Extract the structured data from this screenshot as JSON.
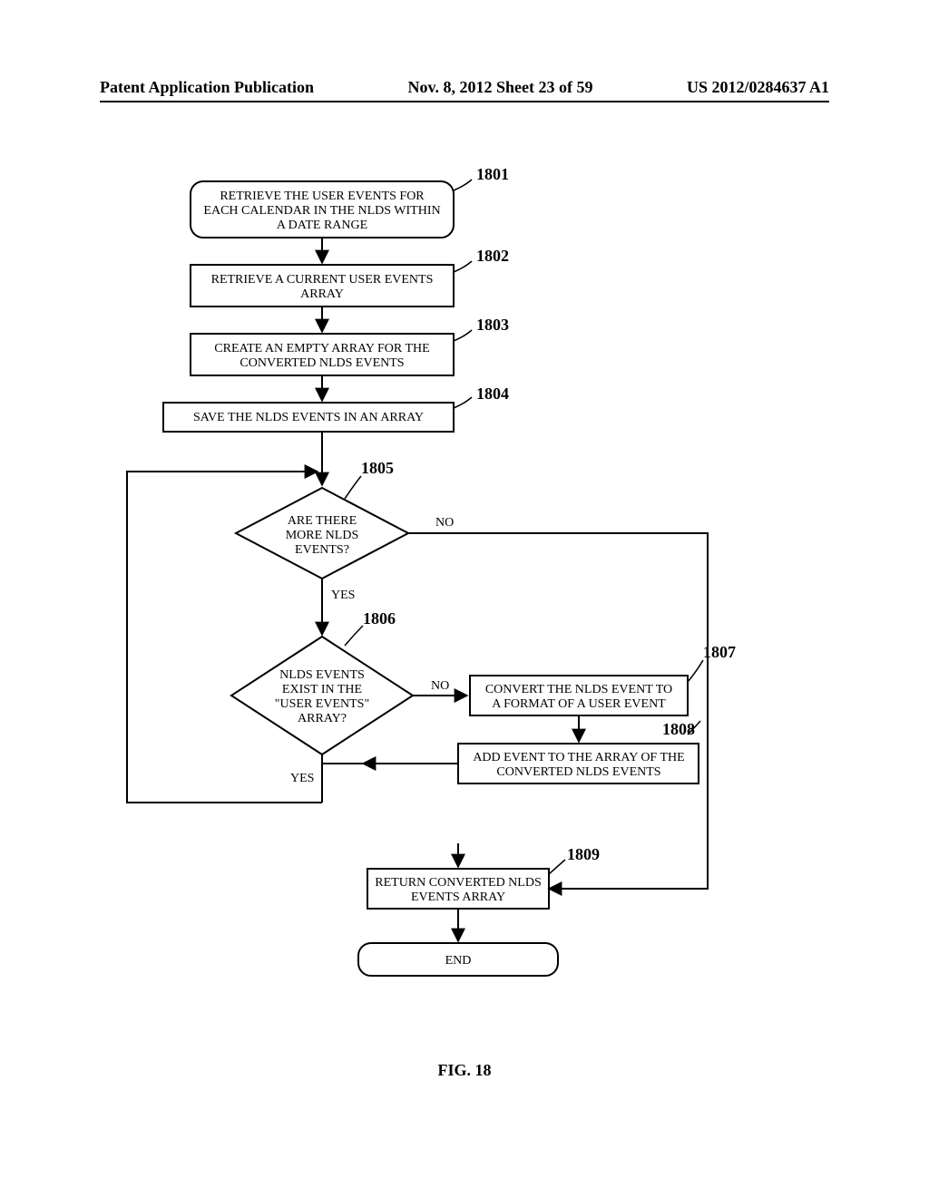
{
  "header": {
    "left": "Patent Application Publication",
    "center": "Nov. 8, 2012  Sheet 23 of 59",
    "right": "US 2012/0284637 A1"
  },
  "figure_caption": "FIG. 18",
  "chart_data": {
    "type": "flowchart",
    "nodes": [
      {
        "id": "1801",
        "shape": "rounded",
        "text": "RETRIEVE THE USER EVENTS FOR EACH CALENDAR IN THE NLDS WITHIN A DATE RANGE"
      },
      {
        "id": "1802",
        "shape": "rect",
        "text": "RETRIEVE A CURRENT USER EVENTS ARRAY"
      },
      {
        "id": "1803",
        "shape": "rect",
        "text": "CREATE AN EMPTY ARRAY FOR THE CONVERTED NLDS EVENTS"
      },
      {
        "id": "1804",
        "shape": "rect",
        "text": "SAVE THE NLDS EVENTS IN AN ARRAY"
      },
      {
        "id": "1805",
        "shape": "diamond",
        "text": "ARE THERE MORE NLDS EVENTS?"
      },
      {
        "id": "1806",
        "shape": "diamond",
        "text": "NLDS EVENTS EXIST IN THE \"USER EVENTS\" ARRAY?"
      },
      {
        "id": "1807",
        "shape": "rect",
        "text": "CONVERT THE NLDS EVENT TO A FORMAT OF A USER EVENT"
      },
      {
        "id": "1808",
        "shape": "rect",
        "text": "ADD EVENT TO THE ARRAY OF THE CONVERTED NLDS EVENTS"
      },
      {
        "id": "1809",
        "shape": "rect",
        "text": "RETURN CONVERTED NLDS EVENTS ARRAY"
      },
      {
        "id": "end",
        "shape": "rounded",
        "text": "END"
      }
    ],
    "edges": [
      {
        "from": "1801",
        "to": "1802"
      },
      {
        "from": "1802",
        "to": "1803"
      },
      {
        "from": "1803",
        "to": "1804"
      },
      {
        "from": "1804",
        "to": "1805"
      },
      {
        "from": "1805",
        "to": "1806",
        "label": "YES"
      },
      {
        "from": "1805",
        "to": "1809",
        "label": "NO"
      },
      {
        "from": "1806",
        "to": "1807",
        "label": "NO"
      },
      {
        "from": "1806",
        "to": "1805",
        "label": "YES",
        "note": "loop back"
      },
      {
        "from": "1807",
        "to": "1808"
      },
      {
        "from": "1808",
        "to": "1805",
        "note": "loop back"
      },
      {
        "from": "1809",
        "to": "end"
      }
    ]
  },
  "labels": {
    "n1801": "1801",
    "n1802": "1802",
    "n1803": "1803",
    "n1804": "1804",
    "n1805": "1805",
    "n1806": "1806",
    "n1807": "1807",
    "n1808": "1808",
    "n1809": "1809",
    "yes": "YES",
    "no": "NO"
  },
  "box_text": {
    "b1801_l1": "RETRIEVE THE USER EVENTS FOR",
    "b1801_l2": "EACH CALENDAR IN THE NLDS WITHIN",
    "b1801_l3": "A DATE RANGE",
    "b1802_l1": "RETRIEVE A CURRENT USER EVENTS",
    "b1802_l2": "ARRAY",
    "b1803_l1": "CREATE AN EMPTY ARRAY FOR THE",
    "b1803_l2": "CONVERTED NLDS EVENTS",
    "b1804_l1": "SAVE THE NLDS EVENTS IN AN ARRAY",
    "b1805_l1": "ARE THERE",
    "b1805_l2": "MORE NLDS",
    "b1805_l3": "EVENTS?",
    "b1806_l1": "NLDS EVENTS",
    "b1806_l2": "EXIST IN THE",
    "b1806_l3": "\"USER EVENTS\"",
    "b1806_l4": "ARRAY?",
    "b1807_l1": "CONVERT THE NLDS EVENT TO",
    "b1807_l2": "A FORMAT OF A USER EVENT",
    "b1808_l1": "ADD EVENT TO THE ARRAY OF THE",
    "b1808_l2": "CONVERTED NLDS EVENTS",
    "b1809_l1": "RETURN CONVERTED NLDS",
    "b1809_l2": "EVENTS ARRAY",
    "end": "END"
  }
}
